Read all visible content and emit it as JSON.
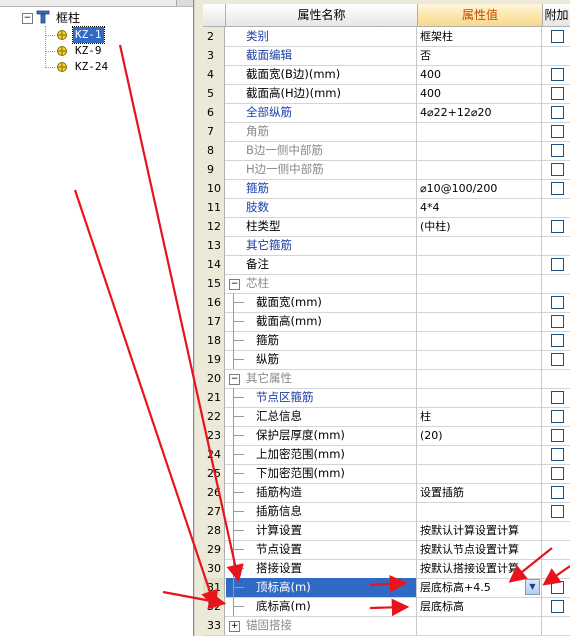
{
  "tree": {
    "root_label": "框柱",
    "items": [
      {
        "label": "KZ-1",
        "selected": true
      },
      {
        "label": "KZ-9",
        "selected": false
      },
      {
        "label": "KZ-24",
        "selected": false
      }
    ]
  },
  "grid": {
    "headers": {
      "name": "属性名称",
      "value": "属性值",
      "add": "附加"
    },
    "rows": [
      {
        "num": "2",
        "name": "类别",
        "value": "框架柱",
        "style": "blue",
        "indent": 0,
        "check": true
      },
      {
        "num": "3",
        "name": "截面编辑",
        "value": "否",
        "style": "blue",
        "indent": 0,
        "check": false
      },
      {
        "num": "4",
        "name": "截面宽(B边)(mm)",
        "value": "400",
        "style": "black",
        "indent": 0,
        "check": true
      },
      {
        "num": "5",
        "name": "截面高(H边)(mm)",
        "value": "400",
        "style": "black",
        "indent": 0,
        "check": true
      },
      {
        "num": "6",
        "name": "全部纵筋",
        "value": "4⌀22+12⌀20",
        "style": "blue",
        "indent": 0,
        "check": true
      },
      {
        "num": "7",
        "name": "角筋",
        "value": "",
        "style": "gray",
        "indent": 0,
        "check": true
      },
      {
        "num": "8",
        "name": "B边一侧中部筋",
        "value": "",
        "style": "gray",
        "indent": 0,
        "check": true
      },
      {
        "num": "9",
        "name": "H边一侧中部筋",
        "value": "",
        "style": "gray",
        "indent": 0,
        "check": true
      },
      {
        "num": "10",
        "name": "箍筋",
        "value": "⌀10@100/200",
        "style": "blue",
        "indent": 0,
        "check": true
      },
      {
        "num": "11",
        "name": "肢数",
        "value": "4*4",
        "style": "blue",
        "indent": 0,
        "check": false
      },
      {
        "num": "12",
        "name": "柱类型",
        "value": "(中柱)",
        "style": "black",
        "indent": 0,
        "check": true
      },
      {
        "num": "13",
        "name": "其它箍筋",
        "value": "",
        "style": "blue",
        "indent": 0,
        "check": false
      },
      {
        "num": "14",
        "name": "备注",
        "value": "",
        "style": "black",
        "indent": 0,
        "check": true
      },
      {
        "num": "15",
        "name": "芯柱",
        "value": "",
        "style": "group",
        "indent": 0,
        "check": false,
        "group": "−"
      },
      {
        "num": "16",
        "name": "截面宽(mm)",
        "value": "",
        "style": "black",
        "indent": 1,
        "check": true
      },
      {
        "num": "17",
        "name": "截面高(mm)",
        "value": "",
        "style": "black",
        "indent": 1,
        "check": true
      },
      {
        "num": "18",
        "name": "箍筋",
        "value": "",
        "style": "black",
        "indent": 1,
        "check": true
      },
      {
        "num": "19",
        "name": "纵筋",
        "value": "",
        "style": "black",
        "indent": 1,
        "check": true
      },
      {
        "num": "20",
        "name": "其它属性",
        "value": "",
        "style": "group",
        "indent": 0,
        "check": false,
        "group": "−"
      },
      {
        "num": "21",
        "name": "节点区箍筋",
        "value": "",
        "style": "blue",
        "indent": 1,
        "check": true
      },
      {
        "num": "22",
        "name": "汇总信息",
        "value": "柱",
        "style": "black",
        "indent": 1,
        "check": true
      },
      {
        "num": "23",
        "name": "保护层厚度(mm)",
        "value": "(20)",
        "style": "black",
        "indent": 1,
        "check": true
      },
      {
        "num": "24",
        "name": "上加密范围(mm)",
        "value": "",
        "style": "black",
        "indent": 1,
        "check": true
      },
      {
        "num": "25",
        "name": "下加密范围(mm)",
        "value": "",
        "style": "black",
        "indent": 1,
        "check": true
      },
      {
        "num": "26",
        "name": "插筋构造",
        "value": "设置插筋",
        "style": "black",
        "indent": 1,
        "check": true
      },
      {
        "num": "27",
        "name": "插筋信息",
        "value": "",
        "style": "black",
        "indent": 1,
        "check": true
      },
      {
        "num": "28",
        "name": "计算设置",
        "value": "按默认计算设置计算",
        "style": "black",
        "indent": 1,
        "check": false
      },
      {
        "num": "29",
        "name": "节点设置",
        "value": "按默认节点设置计算",
        "style": "black",
        "indent": 1,
        "check": false
      },
      {
        "num": "30",
        "name": "搭接设置",
        "value": "按默认搭接设置计算",
        "style": "black",
        "indent": 1,
        "check": false
      },
      {
        "num": "31",
        "name": "顶标高(m)",
        "value": "层底标高+4.5",
        "style": "black",
        "indent": 1,
        "check": true,
        "selected": true
      },
      {
        "num": "32",
        "name": "底标高(m)",
        "value": "层底标高",
        "style": "black",
        "indent": 1,
        "check": true
      },
      {
        "num": "33",
        "name": "锚固搭接",
        "value": "",
        "style": "group",
        "indent": 0,
        "check": false,
        "group": "+"
      }
    ]
  },
  "colors": {
    "annotation_arrow": "#e8141b",
    "selection": "#316ac5",
    "header_value": "#c24a00"
  }
}
